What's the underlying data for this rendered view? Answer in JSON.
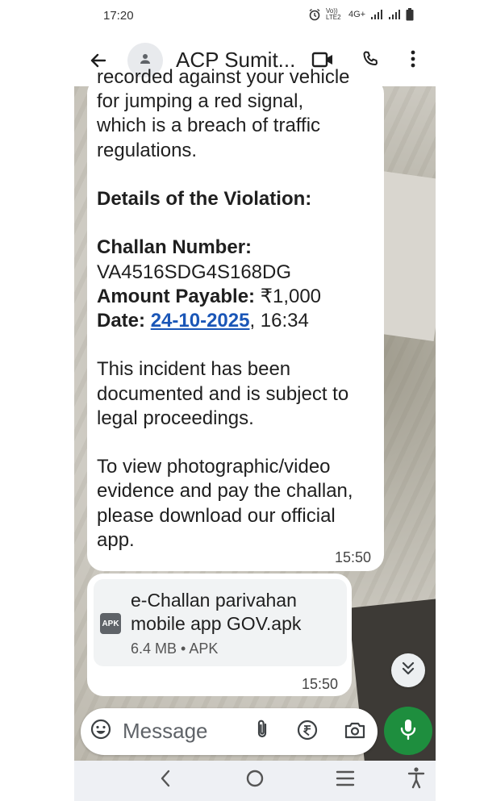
{
  "status_bar": {
    "time": "17:20",
    "volte_label": "Vo)) LTE2",
    "network_label": "4G+",
    "icons": [
      "alarm-icon",
      "volte-icon",
      "signal-icon",
      "signal-icon",
      "battery-icon"
    ]
  },
  "header": {
    "contact_name": "ACP Sumit...",
    "icons": [
      "back-arrow-icon",
      "avatar-person-icon",
      "video-call-icon",
      "phone-icon",
      "more-vert-icon"
    ]
  },
  "message": {
    "cut_line": "recorded against your vehicle",
    "intro_lines": [
      "for jumping a red signal,",
      "which is a breach of traffic",
      "regulations."
    ],
    "details_heading": "Details of the Violation:",
    "challan_label": "Challan Number:",
    "challan_number": "VA4516SDG4S168DG",
    "amount_label": "Amount Payable:",
    "amount_value": " ₹1,000",
    "date_label": "Date:",
    "date_link": "24-10-2025",
    "time_suffix": ", 16:34",
    "incident_lines": [
      "This incident has been",
      "documented and is subject to",
      "legal proceedings."
    ],
    "cta_lines": [
      "To view photographic/video",
      "evidence and pay the challan,",
      "please download our official",
      "app."
    ],
    "timestamp": "15:50"
  },
  "attachment": {
    "icon_label": "APK",
    "file_name_lines": [
      "e-Challan parivahan",
      "mobile app GOV.apk"
    ],
    "file_meta": "6.4 MB • APK",
    "timestamp": "15:50"
  },
  "composer": {
    "placeholder": "Message",
    "icons": [
      "emoji-icon",
      "attach-icon",
      "rupee-payment-icon",
      "camera-icon",
      "mic-icon"
    ]
  },
  "nav_bar": {
    "icons": [
      "nav-back-icon",
      "nav-home-icon",
      "nav-recents-icon",
      "accessibility-icon"
    ]
  },
  "colors": {
    "link": "#1a56b7",
    "mic_button": "#1e8e3e",
    "bubble": "#ffffff"
  }
}
